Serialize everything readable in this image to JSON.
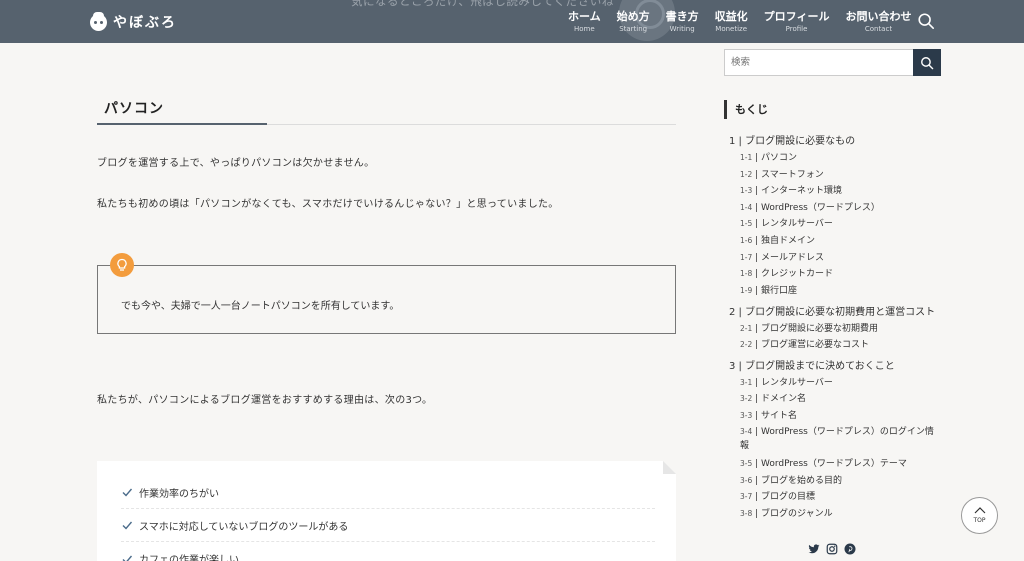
{
  "header": {
    "logo_text": "やぼぶろ",
    "behind_text": "気になるところだけ、飛ばし読みしてくださいね",
    "nav": [
      {
        "jp": "ホーム",
        "en": "Home"
      },
      {
        "jp": "始め方",
        "en": "Starting"
      },
      {
        "jp": "書き方",
        "en": "Writing"
      },
      {
        "jp": "収益化",
        "en": "Monetize"
      },
      {
        "jp": "プロフィール",
        "en": "Profile"
      },
      {
        "jp": "お問い合わせ",
        "en": "Contact"
      }
    ]
  },
  "main": {
    "heading": "パソコン",
    "para1": "ブログを運営する上で、やっぱりパソコンは欠かせません。",
    "para2": "私たちも初めの頃は「パソコンがなくても、スマホだけでいけるんじゃない？」と思っていました。",
    "box_text": "でも今や、夫婦で一人一台ノートパソコンを所有しています。",
    "para3": "私たちが、パソコンによるブログ運営をおすすめする理由は、次の3つ。",
    "list": [
      "作業効率のちがい",
      "スマホに対応していないブログのツールがある",
      "カフェの作業が楽しい"
    ]
  },
  "sidebar": {
    "search_placeholder": "検索",
    "toc_title": "もくじ",
    "toc": [
      {
        "num": "1",
        "label": "ブログ開設に必要なもの",
        "children": [
          {
            "num": "1-1",
            "label": "パソコン"
          },
          {
            "num": "1-2",
            "label": "スマートフォン"
          },
          {
            "num": "1-3",
            "label": "インターネット環境"
          },
          {
            "num": "1-4",
            "label": "WordPress（ワードプレス）"
          },
          {
            "num": "1-5",
            "label": "レンタルサーバー"
          },
          {
            "num": "1-6",
            "label": "独自ドメイン"
          },
          {
            "num": "1-7",
            "label": "メールアドレス"
          },
          {
            "num": "1-8",
            "label": "クレジットカード"
          },
          {
            "num": "1-9",
            "label": "銀行口座"
          }
        ]
      },
      {
        "num": "2",
        "label": "ブログ開設に必要な初期費用と運営コスト",
        "children": [
          {
            "num": "2-1",
            "label": "ブログ開設に必要な初期費用"
          },
          {
            "num": "2-2",
            "label": "ブログ運営に必要なコスト"
          }
        ]
      },
      {
        "num": "3",
        "label": "ブログ開設までに決めておくこと",
        "children": [
          {
            "num": "3-1",
            "label": "レンタルサーバー"
          },
          {
            "num": "3-2",
            "label": "ドメイン名"
          },
          {
            "num": "3-3",
            "label": "サイト名"
          },
          {
            "num": "3-4",
            "label": "WordPress（ワードプレス）のログイン情報"
          },
          {
            "num": "3-5",
            "label": "WordPress（ワードプレス）テーマ"
          },
          {
            "num": "3-6",
            "label": "ブログを始める目的"
          },
          {
            "num": "3-7",
            "label": "ブログの目標"
          },
          {
            "num": "3-8",
            "label": "ブログのジャンル"
          }
        ]
      }
    ]
  },
  "floating": {
    "top_label": "TOP"
  },
  "colors": {
    "header_bg": "#56626e",
    "accent": "#2b3a4a",
    "bulb": "#f39c3d"
  }
}
